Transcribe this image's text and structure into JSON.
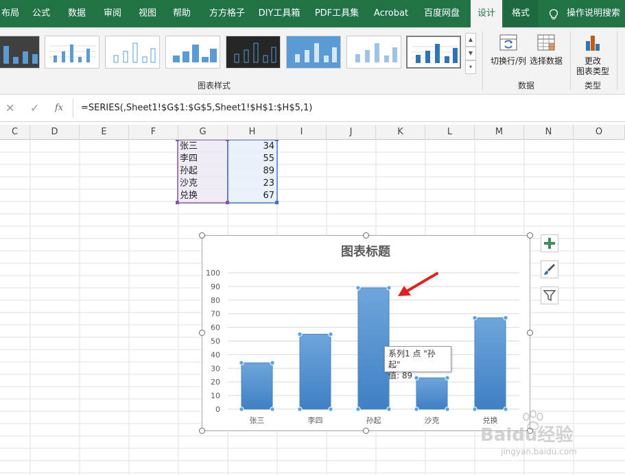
{
  "ribbon_tabs": [
    {
      "label": "布局"
    },
    {
      "label": "公式"
    },
    {
      "label": "数据"
    },
    {
      "label": "审阅"
    },
    {
      "label": "视图"
    },
    {
      "label": "帮助"
    },
    {
      "label": "方方格子"
    },
    {
      "label": "DIY工具箱"
    },
    {
      "label": "PDF工具集"
    },
    {
      "label": "Acrobat"
    },
    {
      "label": "百度网盘"
    },
    {
      "label": "设计"
    },
    {
      "label": "格式"
    }
  ],
  "tell_me": {
    "label": "操作说明搜索",
    "icon": "lightbulb-icon"
  },
  "ribbon": {
    "chart_styles_label": "图表样式",
    "switch_row_col_label": "切换行/列",
    "select_data_label": "选择数据",
    "data_group_label": "数据",
    "change_type_line1": "更改",
    "change_type_line2": "图表类型",
    "type_group_label": "类型"
  },
  "formula_bar": {
    "formula": "=SERIES(,Sheet1!$G$1:$G$5,Sheet1!$H$1:$H$5,1)",
    "fx_label": "fx",
    "cancel_icon": "close-icon",
    "enter_icon": "check-icon"
  },
  "columns": [
    "C",
    "D",
    "E",
    "F",
    "G",
    "H",
    "I",
    "J",
    "K",
    "L",
    "M",
    "N",
    "O"
  ],
  "table": {
    "rows": [
      {
        "name": "张三",
        "value": "34"
      },
      {
        "name": "李四",
        "value": "55"
      },
      {
        "name": "孙起",
        "value": "89"
      },
      {
        "name": "沙克",
        "value": "23"
      },
      {
        "name": "兑换",
        "value": "67"
      }
    ]
  },
  "chart_data": {
    "type": "bar",
    "title": "图表标题",
    "categories": [
      "张三",
      "李四",
      "孙起",
      "沙克",
      "兑换"
    ],
    "series": [
      {
        "values": [
          34,
          55,
          89,
          23,
          67
        ]
      }
    ],
    "ylim": [
      0,
      100
    ],
    "yticks": [
      "0",
      "10",
      "20",
      "30",
      "40",
      "50",
      "60",
      "70",
      "80",
      "90",
      "100"
    ],
    "grid": true,
    "bar_color": "#5b9bd5"
  },
  "tooltip": {
    "line1": "系列1 点 \"孙起\"",
    "line2": "值: 89"
  },
  "chart_side_buttons": [
    "plus-icon",
    "brush-icon",
    "filter-icon"
  ],
  "watermark": {
    "text": "Baidu经验",
    "subtext": "jingyan.baidu.com"
  },
  "colors": {
    "excel_green": "#217346",
    "accent_arrow": "#e02020"
  }
}
